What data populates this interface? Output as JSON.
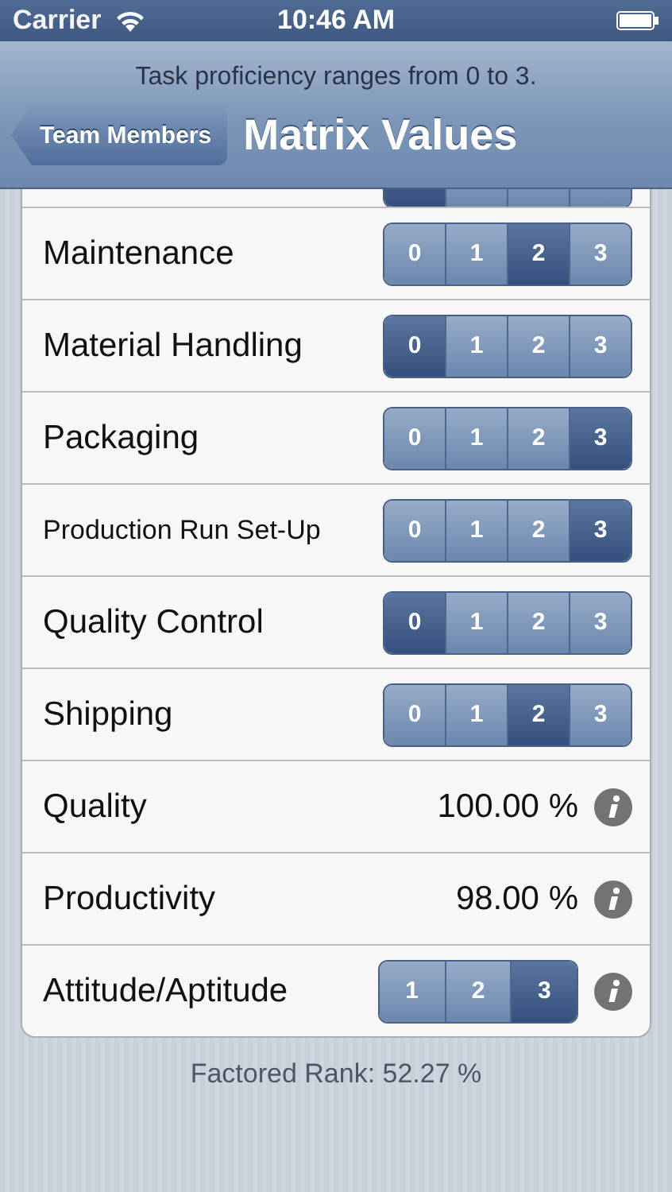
{
  "status_bar": {
    "carrier": "Carrier",
    "time": "10:46 AM"
  },
  "prompt": "Task proficiency ranges from 0 to 3.",
  "nav": {
    "back": "Team Members",
    "title": "Matrix Values"
  },
  "cut_row": {
    "segments": [
      {
        "selected": true
      },
      {
        "selected": false
      },
      {
        "selected": false
      },
      {
        "selected": false
      }
    ]
  },
  "rows": [
    {
      "kind": "segmented",
      "label": "Maintenance",
      "segments": [
        {
          "label": "0",
          "selected": false
        },
        {
          "label": "1",
          "selected": false
        },
        {
          "label": "2",
          "selected": true
        },
        {
          "label": "3",
          "selected": false
        }
      ]
    },
    {
      "kind": "segmented",
      "label": "Material Handling",
      "segments": [
        {
          "label": "0",
          "selected": true
        },
        {
          "label": "1",
          "selected": false
        },
        {
          "label": "2",
          "selected": false
        },
        {
          "label": "3",
          "selected": false
        }
      ]
    },
    {
      "kind": "segmented",
      "label": "Packaging",
      "segments": [
        {
          "label": "0",
          "selected": false
        },
        {
          "label": "1",
          "selected": false
        },
        {
          "label": "2",
          "selected": false
        },
        {
          "label": "3",
          "selected": true
        }
      ]
    },
    {
      "kind": "segmented",
      "label": "Production Run Set-Up",
      "small": true,
      "segments": [
        {
          "label": "0",
          "selected": false
        },
        {
          "label": "1",
          "selected": false
        },
        {
          "label": "2",
          "selected": false
        },
        {
          "label": "3",
          "selected": true
        }
      ]
    },
    {
      "kind": "segmented",
      "label": "Quality Control",
      "segments": [
        {
          "label": "0",
          "selected": true
        },
        {
          "label": "1",
          "selected": false
        },
        {
          "label": "2",
          "selected": false
        },
        {
          "label": "3",
          "selected": false
        }
      ]
    },
    {
      "kind": "segmented",
      "label": "Shipping",
      "segments": [
        {
          "label": "0",
          "selected": false
        },
        {
          "label": "1",
          "selected": false
        },
        {
          "label": "2",
          "selected": true
        },
        {
          "label": "3",
          "selected": false
        }
      ]
    },
    {
      "kind": "value",
      "label": "Quality",
      "value": "100.00 %",
      "info": true
    },
    {
      "kind": "value",
      "label": "Productivity",
      "value": "98.00 %",
      "info": true
    },
    {
      "kind": "segmented",
      "label": "Attitude/Aptitude",
      "info": true,
      "segments": [
        {
          "label": "1",
          "selected": false
        },
        {
          "label": "2",
          "selected": false
        },
        {
          "label": "3",
          "selected": true
        }
      ]
    }
  ],
  "footer": "Factored Rank: 52.27 %"
}
